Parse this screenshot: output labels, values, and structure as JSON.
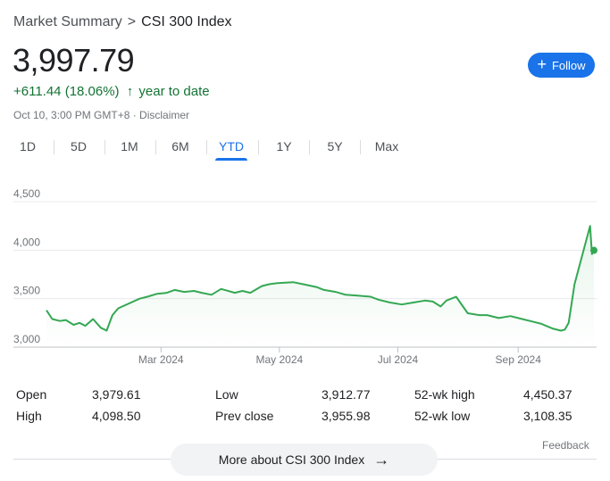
{
  "breadcrumb": {
    "root": "Market Summary",
    "separator": ">",
    "current": "CSI 300 Index"
  },
  "price": "3,997.79",
  "change": {
    "text": "+611.44 (18.06%)",
    "arrow": "↑",
    "period": "year to date"
  },
  "timestamp": "Oct 10, 3:00 PM GMT+8 · Disclaimer",
  "follow": {
    "icon": "+",
    "label": "Follow"
  },
  "tabs": [
    {
      "label": "1D",
      "active": false
    },
    {
      "label": "5D",
      "active": false
    },
    {
      "label": "1M",
      "active": false
    },
    {
      "label": "6M",
      "active": false
    },
    {
      "label": "YTD",
      "active": true
    },
    {
      "label": "1Y",
      "active": false
    },
    {
      "label": "5Y",
      "active": false
    },
    {
      "label": "Max",
      "active": false
    }
  ],
  "colors": {
    "accent": "#1a73e8",
    "positive": "#137333",
    "line": "#34a853"
  },
  "chart_data": {
    "type": "line",
    "yticks": [
      "4,500",
      "4,000",
      "3,500",
      "3,000"
    ],
    "ytick_values": [
      4500,
      4000,
      3500,
      3000
    ],
    "xticks": [
      "Mar 2024",
      "May 2024",
      "Jul 2024",
      "Sep 2024"
    ],
    "xtick_dates": [
      "2024-03-01",
      "2024-05-01",
      "2024-07-01",
      "2024-09-01"
    ],
    "ylim": [
      3000,
      4500
    ],
    "x_range": [
      "2024-01-02",
      "2024-10-10"
    ],
    "grid": true,
    "series": [
      {
        "x": [
          "2024-01-02",
          "2024-01-05",
          "2024-01-09",
          "2024-01-12",
          "2024-01-16",
          "2024-01-19",
          "2024-01-22",
          "2024-01-26",
          "2024-01-30",
          "2024-02-02",
          "2024-02-05",
          "2024-02-08",
          "2024-02-19",
          "2024-02-23",
          "2024-02-28",
          "2024-03-04",
          "2024-03-08",
          "2024-03-13",
          "2024-03-18",
          "2024-03-22",
          "2024-03-27",
          "2024-04-01",
          "2024-04-08",
          "2024-04-12",
          "2024-04-16",
          "2024-04-22",
          "2024-04-26",
          "2024-04-30",
          "2024-05-08",
          "2024-05-13",
          "2024-05-20",
          "2024-05-24",
          "2024-05-30",
          "2024-06-04",
          "2024-06-11",
          "2024-06-17",
          "2024-06-21",
          "2024-06-27",
          "2024-07-03",
          "2024-07-09",
          "2024-07-15",
          "2024-07-19",
          "2024-07-23",
          "2024-07-26",
          "2024-07-31",
          "2024-08-06",
          "2024-08-12",
          "2024-08-16",
          "2024-08-22",
          "2024-08-28",
          "2024-09-03",
          "2024-09-09",
          "2024-09-13",
          "2024-09-19",
          "2024-09-23",
          "2024-09-25",
          "2024-09-27",
          "2024-09-30",
          "2024-10-08",
          "2024-10-09",
          "2024-10-10"
        ],
        "values": [
          3380,
          3290,
          3270,
          3280,
          3230,
          3250,
          3220,
          3290,
          3200,
          3170,
          3330,
          3400,
          3500,
          3520,
          3550,
          3560,
          3590,
          3570,
          3580,
          3560,
          3540,
          3600,
          3560,
          3580,
          3560,
          3630,
          3650,
          3660,
          3670,
          3650,
          3620,
          3590,
          3570,
          3540,
          3530,
          3520,
          3490,
          3460,
          3440,
          3460,
          3480,
          3470,
          3420,
          3480,
          3520,
          3350,
          3330,
          3330,
          3300,
          3320,
          3290,
          3260,
          3240,
          3190,
          3170,
          3180,
          3250,
          3650,
          4250,
          3960,
          3998
        ]
      }
    ]
  },
  "stats": [
    {
      "label": "Open",
      "value": "3,979.61"
    },
    {
      "label": "High",
      "value": "4,098.50"
    },
    {
      "label": "Low",
      "value": "3,912.77"
    },
    {
      "label": "Prev close",
      "value": "3,955.98"
    },
    {
      "label": "52-wk high",
      "value": "4,450.37"
    },
    {
      "label": "52-wk low",
      "value": "3,108.35"
    }
  ],
  "feedback": "Feedback",
  "more": {
    "label": "More about CSI 300 Index",
    "icon": "→"
  }
}
